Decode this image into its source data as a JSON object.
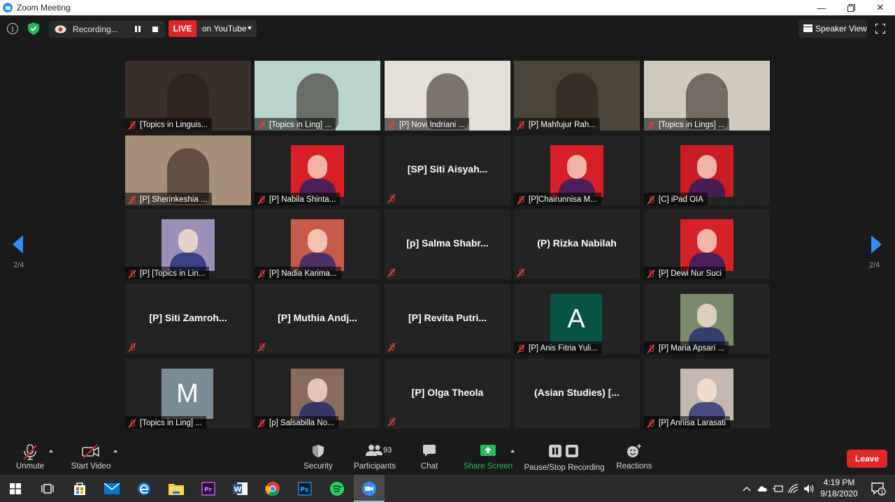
{
  "window": {
    "title": "Zoom Meeting",
    "minimize_icon": "minimize-icon",
    "restore_icon": "restore-icon",
    "close_icon": "close-icon"
  },
  "topbar": {
    "recording_label": "Recording...",
    "live_label": "LIVE",
    "live_target": "on YouTube",
    "view_label": "Speaker View"
  },
  "tiles": [
    {
      "label": "[Topics in Linguis...",
      "type": "video",
      "bg": "#3a2f2a"
    },
    {
      "label": "[Topics in Ling] ...",
      "type": "video",
      "bg": "#b9d4cc"
    },
    {
      "label": "[P] Novi Indriani ...",
      "type": "video",
      "bg": "#e5e0d7"
    },
    {
      "label": "[P] Mahfujur Rah...",
      "type": "video",
      "bg": "#4a4538"
    },
    {
      "label": "[Topics in Lings] ...",
      "type": "video",
      "bg": "#cfcabd"
    },
    {
      "label": "[P] Sherinkeshia ...",
      "type": "video",
      "bg": "#a88f78"
    },
    {
      "label": "[P] Nabila Shinta...",
      "type": "photo",
      "bg": "#d81f26"
    },
    {
      "name": "[SP]  Siti  Aisyah...",
      "type": "name"
    },
    {
      "label": "[P]Chairunnisa M...",
      "type": "photo",
      "bg": "#d81f26"
    },
    {
      "label": "[C] iPad OIA",
      "type": "photo",
      "bg": "#c91d22"
    },
    {
      "label": "[P] [Topics in Lin...",
      "type": "photo",
      "bg": "#9b8fb8"
    },
    {
      "label": "[P] Nadia Karima...",
      "type": "photo",
      "bg": "#c85a4a"
    },
    {
      "name": "[p]  Salma  Shabr...",
      "type": "name"
    },
    {
      "name": "(P) Rizka Nabilah",
      "type": "name"
    },
    {
      "label": "[P] Dewi Nur Suci",
      "type": "photo",
      "bg": "#d42227"
    },
    {
      "name": "[P]  Siti  Zamroh...",
      "type": "name"
    },
    {
      "name": "[P]  Muthia  Andj...",
      "type": "name"
    },
    {
      "name": "[P]  Revita  Putri...",
      "type": "name"
    },
    {
      "label": "[P] Anis Fitria Yuli...",
      "type": "avatar",
      "letter": "A",
      "bg": "#0b5345"
    },
    {
      "label": "[P] Maria Apsari ...",
      "type": "photo",
      "bg": "#7a8a6a"
    },
    {
      "label": "[Topics in Ling] ...",
      "type": "avatar",
      "letter": "M",
      "bg": "#7a8c96"
    },
    {
      "label": "[p] Salsabilla No...",
      "type": "photo",
      "bg": "#8a6a5a"
    },
    {
      "name": "[P] Olga Theola",
      "type": "name"
    },
    {
      "name": "(Asian Studies)  [...",
      "type": "name",
      "nomute": true
    },
    {
      "label": "[P] Annisa Larasati",
      "type": "photo",
      "bg": "#c4b8b0"
    }
  ],
  "pagination": {
    "left": "2/4",
    "right": "2/4"
  },
  "toolbar": {
    "unmute": "Unmute",
    "start_video": "Start Video",
    "security": "Security",
    "participants": "Participants",
    "participants_count": "93",
    "chat": "Chat",
    "share_screen": "Share Screen",
    "pause_stop": "Pause/Stop Recording",
    "reactions": "Reactions",
    "leave": "Leave"
  },
  "taskbar": {
    "time": "4:19 PM",
    "date": "9/18/2020",
    "notification_count": "1"
  },
  "colors": {
    "accent": "#2d8cff",
    "live": "#e02828",
    "share": "#22b95a"
  }
}
